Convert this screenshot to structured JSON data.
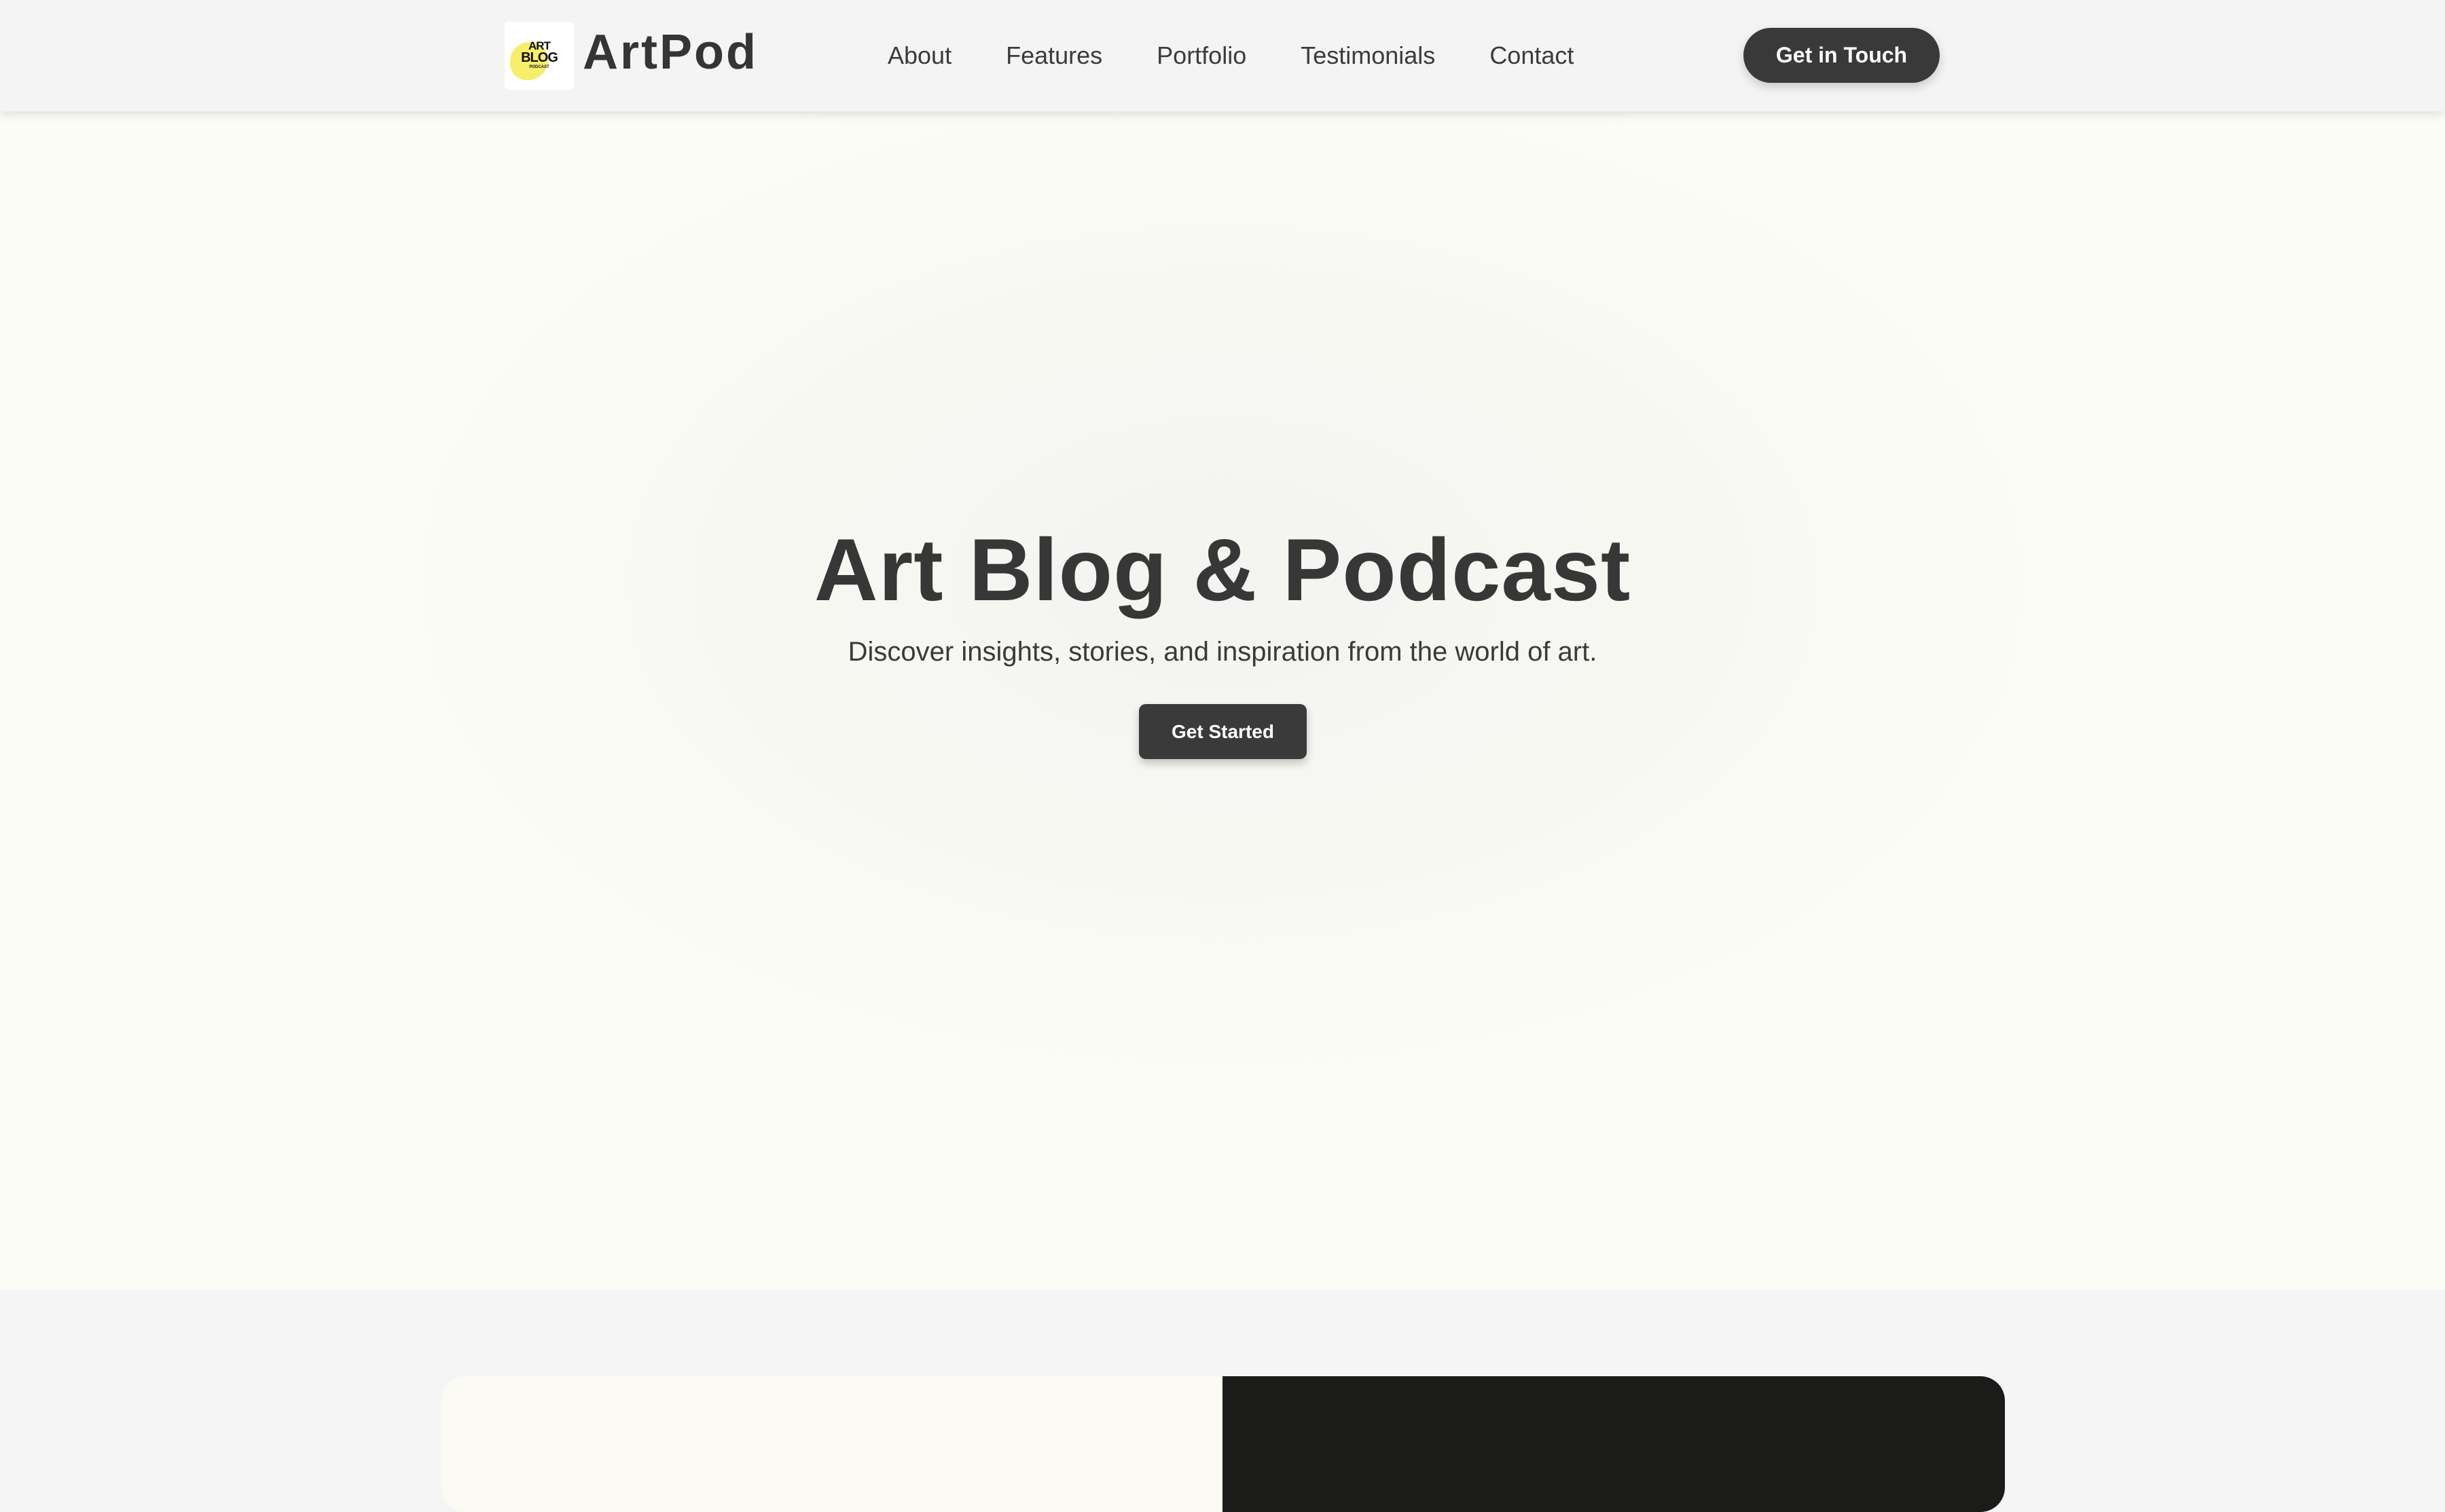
{
  "header": {
    "logo": {
      "line1": "ART",
      "line2": "BLOG",
      "line3": "PODCAST"
    },
    "brand_name": "ArtPod",
    "nav": [
      {
        "label": "About"
      },
      {
        "label": "Features"
      },
      {
        "label": "Portfolio"
      },
      {
        "label": "Testimonials"
      },
      {
        "label": "Contact"
      }
    ],
    "cta_label": "Get in Touch"
  },
  "hero": {
    "title": "Art Blog & Podcast",
    "subtitle": "Discover insights, stories, and inspiration from the world of art.",
    "button_label": "Get Started"
  },
  "colors": {
    "primary_dark": "#393939",
    "header_bg": "#f4f4f4",
    "hero_bg": "#fcfcf6",
    "logo_accent": "#f7ee6a",
    "card_dark": "#1b1b19"
  }
}
